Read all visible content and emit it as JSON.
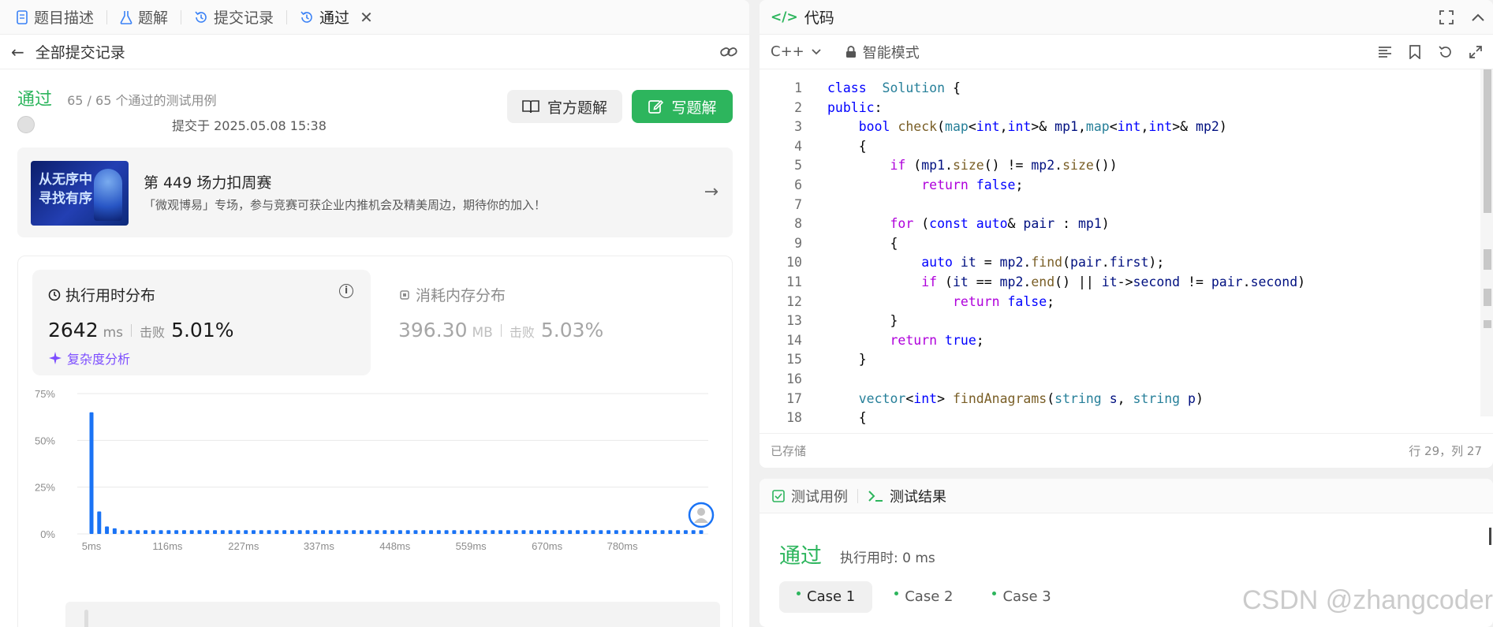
{
  "tabs": [
    {
      "label": "题目描述",
      "icon": "document-icon"
    },
    {
      "label": "题解",
      "icon": "flask-icon"
    },
    {
      "label": "提交记录",
      "icon": "history-icon"
    },
    {
      "label": "通过",
      "icon": "history-icon",
      "active": true
    }
  ],
  "subbar": {
    "back_label": "全部提交记录"
  },
  "result": {
    "status": "通过",
    "passed_text": "65 / 65 个通过的测试用例",
    "submitted_at": "提交于 2025.05.08 15:38",
    "official_solution": "官方题解",
    "write_solution": "写题解"
  },
  "banner": {
    "image_text_1": "从无序中",
    "image_text_2": "寻找有序",
    "title": "第 449 场力扣周赛",
    "desc": "「微观博易」专场，参与竞赛可获企业内推机会及精美周边，期待你的加入！"
  },
  "performance": {
    "runtime_title": "执行用时分布",
    "runtime_value": "2642",
    "runtime_unit": "ms",
    "beat_label": "击败",
    "runtime_beat": "5.01%",
    "complexity_link": "复杂度分析",
    "memory_title": "消耗内存分布",
    "memory_value": "396.30",
    "memory_unit": "MB",
    "memory_beat": "5.03%"
  },
  "chart_data": {
    "type": "bar",
    "title": "",
    "xlabel": "",
    "ylabel": "",
    "ylim": [
      0,
      75
    ],
    "y_ticks": [
      "75%",
      "50%",
      "25%",
      "0%"
    ],
    "x_ticks": [
      "5ms",
      "116ms",
      "227ms",
      "337ms",
      "448ms",
      "559ms",
      "670ms",
      "780ms"
    ],
    "x_range_ms": [
      5,
      895
    ],
    "values": [
      65,
      12,
      4,
      3,
      2,
      2,
      2,
      2,
      2,
      2,
      2,
      2,
      2,
      2,
      2,
      2,
      2,
      2,
      2,
      2,
      2,
      2,
      2,
      2,
      2,
      2,
      2,
      2,
      2,
      2,
      2,
      2,
      2,
      2,
      2,
      2,
      2,
      2,
      2,
      2,
      2,
      2,
      2,
      2,
      2,
      2,
      2,
      2,
      2,
      2,
      2,
      2,
      2,
      2,
      2,
      2,
      2,
      2,
      2,
      2,
      2,
      2,
      2,
      2,
      2,
      2,
      2,
      2,
      2,
      2,
      2,
      2,
      2,
      2,
      2,
      2,
      2,
      2,
      2,
      2
    ],
    "bar_color": "#1a73f5",
    "grid": true,
    "marker": "user-avatar at rightmost bar"
  },
  "code_panel": {
    "title": "代码",
    "language": "C++",
    "mode": "智能模式",
    "saved": "已存储",
    "cursor": "行 29，列 27",
    "lines": [
      {
        "n": "1",
        "tokens": [
          [
            "kw",
            "class"
          ],
          [
            "",
            "  "
          ],
          [
            "ty",
            "Solution"
          ],
          [
            "",
            " {"
          ]
        ]
      },
      {
        "n": "2",
        "tokens": [
          [
            "kw",
            "public"
          ],
          [
            "",
            ":"
          ]
        ]
      },
      {
        "n": "3",
        "tokens": [
          [
            "",
            "    "
          ],
          [
            "kw",
            "bool"
          ],
          [
            "",
            " "
          ],
          [
            "fn",
            "check"
          ],
          [
            "",
            "("
          ],
          [
            "ty",
            "map"
          ],
          [
            "",
            "<"
          ],
          [
            "kw",
            "int"
          ],
          [
            "",
            ","
          ],
          [
            "kw",
            "int"
          ],
          [
            "",
            ">& "
          ],
          [
            "var",
            "mp1"
          ],
          [
            "",
            ","
          ],
          [
            "ty",
            "map"
          ],
          [
            "",
            "<"
          ],
          [
            "kw",
            "int"
          ],
          [
            "",
            ","
          ],
          [
            "kw",
            "int"
          ],
          [
            "",
            ">& "
          ],
          [
            "var",
            "mp2"
          ],
          [
            "",
            ")"
          ]
        ]
      },
      {
        "n": "4",
        "tokens": [
          [
            "",
            "    {"
          ]
        ]
      },
      {
        "n": "5",
        "tokens": [
          [
            "",
            "        "
          ],
          [
            "kw2",
            "if"
          ],
          [
            "",
            " ("
          ],
          [
            "var",
            "mp1"
          ],
          [
            "",
            "."
          ],
          [
            "fn",
            "size"
          ],
          [
            "",
            "() != "
          ],
          [
            "var",
            "mp2"
          ],
          [
            "",
            "."
          ],
          [
            "fn",
            "size"
          ],
          [
            "",
            "())"
          ]
        ]
      },
      {
        "n": "6",
        "tokens": [
          [
            "",
            "            "
          ],
          [
            "kw2",
            "return"
          ],
          [
            "",
            " "
          ],
          [
            "kw",
            "false"
          ],
          [
            "",
            ";"
          ]
        ]
      },
      {
        "n": "7",
        "tokens": [
          [
            "",
            ""
          ]
        ]
      },
      {
        "n": "8",
        "tokens": [
          [
            "",
            "        "
          ],
          [
            "kw2",
            "for"
          ],
          [
            "",
            " ("
          ],
          [
            "kw",
            "const"
          ],
          [
            "",
            " "
          ],
          [
            "kw",
            "auto"
          ],
          [
            "",
            "& "
          ],
          [
            "var",
            "pair"
          ],
          [
            "",
            " : "
          ],
          [
            "var",
            "mp1"
          ],
          [
            "",
            ")"
          ]
        ]
      },
      {
        "n": "9",
        "tokens": [
          [
            "",
            "        {"
          ]
        ]
      },
      {
        "n": "10",
        "tokens": [
          [
            "",
            "            "
          ],
          [
            "kw",
            "auto"
          ],
          [
            "",
            " "
          ],
          [
            "var",
            "it"
          ],
          [
            "",
            " = "
          ],
          [
            "var",
            "mp2"
          ],
          [
            "",
            "."
          ],
          [
            "fn",
            "find"
          ],
          [
            "",
            "("
          ],
          [
            "var",
            "pair"
          ],
          [
            "",
            "."
          ],
          [
            "var",
            "first"
          ],
          [
            "",
            ");"
          ]
        ]
      },
      {
        "n": "11",
        "tokens": [
          [
            "",
            "            "
          ],
          [
            "kw2",
            "if"
          ],
          [
            "",
            " ("
          ],
          [
            "var",
            "it"
          ],
          [
            "",
            " == "
          ],
          [
            "var",
            "mp2"
          ],
          [
            "",
            "."
          ],
          [
            "fn",
            "end"
          ],
          [
            "",
            "() || "
          ],
          [
            "var",
            "it"
          ],
          [
            "",
            "->"
          ],
          [
            "var",
            "second"
          ],
          [
            "",
            " != "
          ],
          [
            "var",
            "pair"
          ],
          [
            "",
            "."
          ],
          [
            "var",
            "second"
          ],
          [
            "",
            ")"
          ]
        ]
      },
      {
        "n": "12",
        "tokens": [
          [
            "",
            "                "
          ],
          [
            "kw2",
            "return"
          ],
          [
            "",
            " "
          ],
          [
            "kw",
            "false"
          ],
          [
            "",
            ";"
          ]
        ]
      },
      {
        "n": "13",
        "tokens": [
          [
            "",
            "        }"
          ]
        ]
      },
      {
        "n": "14",
        "tokens": [
          [
            "",
            "        "
          ],
          [
            "kw2",
            "return"
          ],
          [
            "",
            " "
          ],
          [
            "kw",
            "true"
          ],
          [
            "",
            ";"
          ]
        ]
      },
      {
        "n": "15",
        "tokens": [
          [
            "",
            "    }"
          ]
        ]
      },
      {
        "n": "16",
        "tokens": [
          [
            "",
            ""
          ]
        ]
      },
      {
        "n": "17",
        "tokens": [
          [
            "",
            "    "
          ],
          [
            "ty",
            "vector"
          ],
          [
            "",
            "<"
          ],
          [
            "kw",
            "int"
          ],
          [
            "",
            "> "
          ],
          [
            "fn",
            "findAnagrams"
          ],
          [
            "",
            "("
          ],
          [
            "ty",
            "string"
          ],
          [
            "",
            " "
          ],
          [
            "var",
            "s"
          ],
          [
            "",
            ", "
          ],
          [
            "ty",
            "string"
          ],
          [
            "",
            " "
          ],
          [
            "var",
            "p"
          ],
          [
            "",
            ")"
          ]
        ]
      },
      {
        "n": "18",
        "tokens": [
          [
            "",
            "    {"
          ]
        ]
      }
    ]
  },
  "test_panel": {
    "tab_cases": "测试用例",
    "tab_result": "测试结果",
    "status": "通过",
    "time": "执行用时: 0 ms",
    "cases": [
      "Case 1",
      "Case 2",
      "Case 3"
    ]
  },
  "watermark": "CSDN @zhangcoder"
}
